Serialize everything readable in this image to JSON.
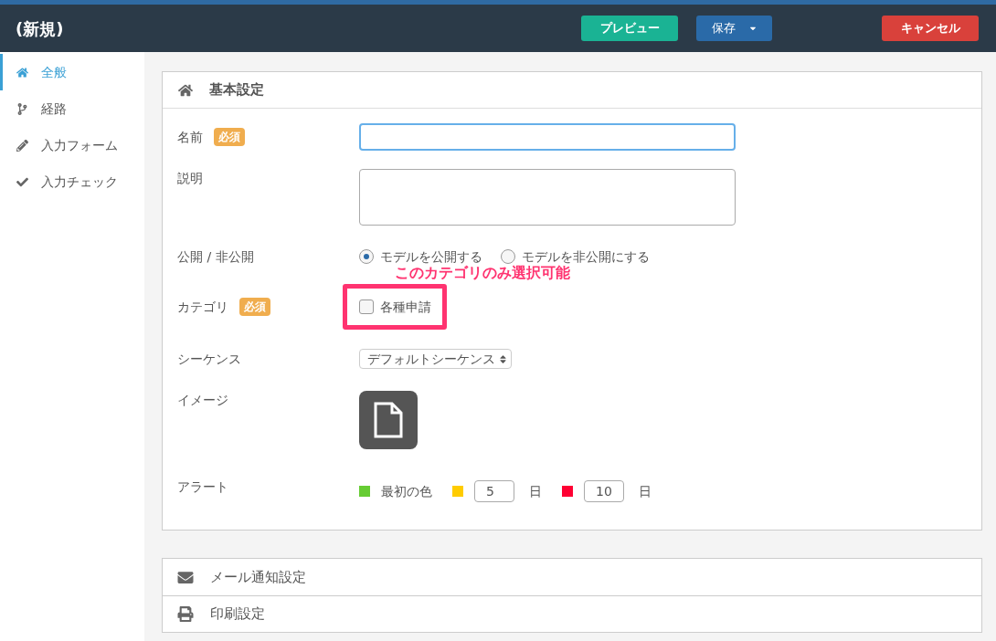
{
  "header": {
    "title": "(新規)",
    "buttons": [
      {
        "kind": "preview",
        "label": "プレビュー"
      },
      {
        "kind": "save",
        "label": "保存"
      },
      {
        "kind": "cancel",
        "label": "キャンセル"
      }
    ]
  },
  "sidebar": {
    "items": [
      {
        "kind": "home",
        "label": "全般",
        "selected": true
      },
      {
        "kind": "branch",
        "label": "経路",
        "selected": false
      },
      {
        "kind": "pencil",
        "label": "入力フォーム",
        "selected": false
      },
      {
        "kind": "check",
        "label": "入力チェック",
        "selected": false
      }
    ]
  },
  "panel": {
    "title": "基本設定",
    "fields": [
      {
        "kind": "text",
        "label": "名前",
        "required_badge": "必須"
      },
      {
        "kind": "textarea",
        "label": "説明"
      },
      {
        "kind": "radios",
        "label": "公開 / 非公開",
        "options": [
          {
            "label": "モデルを公開する",
            "selected": true
          },
          {
            "label": "モデルを非公開にする",
            "selected": false
          }
        ]
      },
      {
        "kind": "checkboxes",
        "label": "カテゴリ",
        "required_badge": "必須",
        "options": [
          {
            "label": "各種申請",
            "checked": false
          }
        ]
      },
      {
        "kind": "select",
        "label": "シーケンス",
        "value": "デフォルトシーケンス"
      },
      {
        "kind": "image",
        "label": "イメージ"
      },
      {
        "kind": "alert",
        "label": "アラート",
        "items": [
          {
            "kind": "label",
            "color": "#66cc33",
            "text": "最初の色"
          },
          {
            "kind": "input",
            "color": "#ffcc00",
            "value": "5",
            "unit": "日"
          },
          {
            "kind": "input",
            "color": "#ff0033",
            "value": "10",
            "unit": "日"
          }
        ]
      }
    ]
  },
  "annotation": {
    "text": "このカテゴリのみ選択可能"
  },
  "sections": [
    {
      "kind": "mail",
      "title": "メール通知設定"
    },
    {
      "kind": "print",
      "title": "印刷設定"
    }
  ]
}
